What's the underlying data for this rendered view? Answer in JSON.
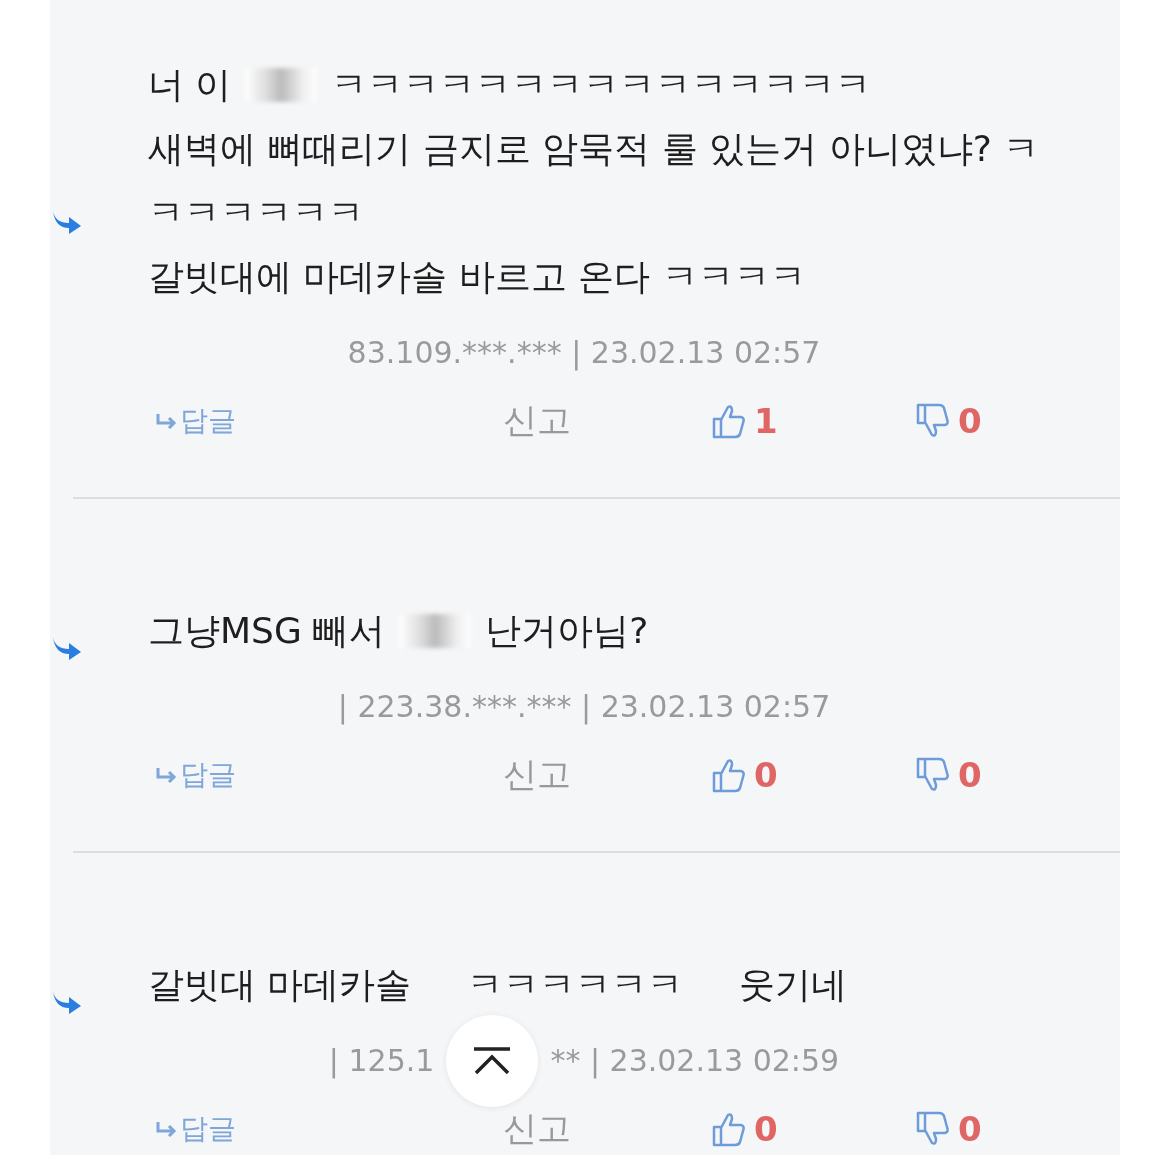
{
  "comments": [
    {
      "lines": [
        [
          {
            "kind": "text",
            "text": "너 이"
          },
          {
            "kind": "censor"
          },
          {
            "kind": "text",
            "text": "ㅋㅋㅋㅋㅋㅋㅋㅋㅋㅋㅋㅋㅋㅋㅋ"
          }
        ],
        [
          {
            "kind": "text",
            "text": "새벽에 뼈때리기 금지로 암묵적 룰 있는거 아니였냐? ㅋ"
          }
        ],
        [
          {
            "kind": "text",
            "text": "ㅋㅋㅋㅋㅋㅋ"
          }
        ],
        [
          {
            "kind": "text",
            "text": "갈빗대에 마데카솔 바르고 온다 ㅋㅋㅋㅋ"
          }
        ]
      ],
      "meta": [
        "83.109.***.*** | 23.02.13 02:57"
      ],
      "reply": "답글",
      "report": "신고",
      "likes": "1",
      "dislikes": "0"
    },
    {
      "lines": [
        [
          {
            "kind": "text",
            "text": "그냥MSG 빼서"
          },
          {
            "kind": "censor"
          },
          {
            "kind": "text",
            "text": "난거아님?"
          }
        ]
      ],
      "meta": [
        "| 223.38.***.*** | 23.02.13 02:57"
      ],
      "reply": "답글",
      "report": "신고",
      "likes": "0",
      "dislikes": "0"
    },
    {
      "lines": [
        [
          {
            "kind": "text",
            "text": "갈빗대 마데카솔"
          },
          {
            "kind": "text",
            "text": "ㅋㅋㅋㅋㅋㅋ"
          },
          {
            "kind": "text",
            "text": "웃기네"
          }
        ]
      ],
      "meta": [
        "| 125.1",
        "** | 23.02.13 02:59"
      ],
      "reply": "답글",
      "report": "신고",
      "likes": "0",
      "dislikes": "0"
    }
  ]
}
